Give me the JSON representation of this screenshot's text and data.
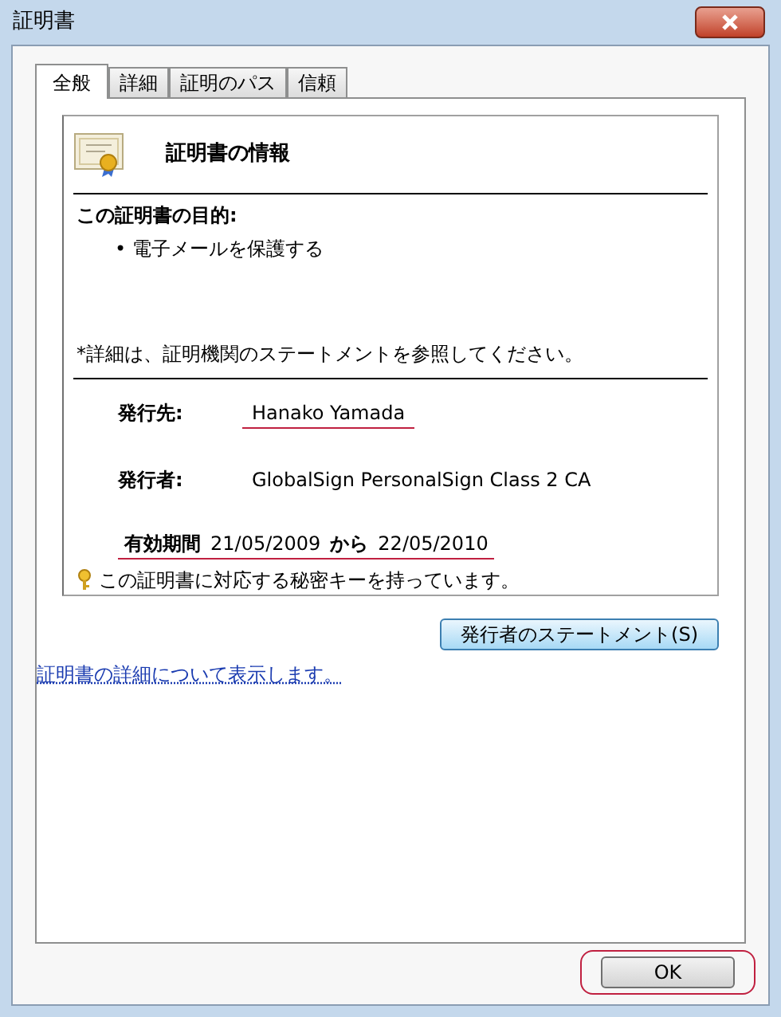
{
  "window": {
    "title": "証明書"
  },
  "tabs": [
    {
      "label": "全般",
      "selected": true
    },
    {
      "label": "詳細",
      "selected": false
    },
    {
      "label": "証明のパス",
      "selected": false
    },
    {
      "label": "信頼",
      "selected": false
    }
  ],
  "info": {
    "heading": "証明書の情報",
    "purpose_title": "この証明書の目的:",
    "purposes": [
      "• 電子メールを保護する"
    ],
    "note": "*詳細は、証明機関のステートメントを参照してください。",
    "fields": [
      {
        "label": "発行先:",
        "value": "Hanako Yamada",
        "highlighted": true
      },
      {
        "label": "発行者:",
        "value": "GlobalSign PersonalSign Class 2 CA",
        "highlighted": false
      }
    ],
    "validity": {
      "label": "有効期間",
      "from": "21/05/2009",
      "connector": "から",
      "to": "22/05/2010",
      "highlighted": true
    },
    "private_key_note": "この証明書に対応する秘密キーを持っています。"
  },
  "statement_button": "発行者のステートメント(S)",
  "details_link": "証明書の詳細について表示します。",
  "ok_button": {
    "label": "OK",
    "highlighted": true
  }
}
